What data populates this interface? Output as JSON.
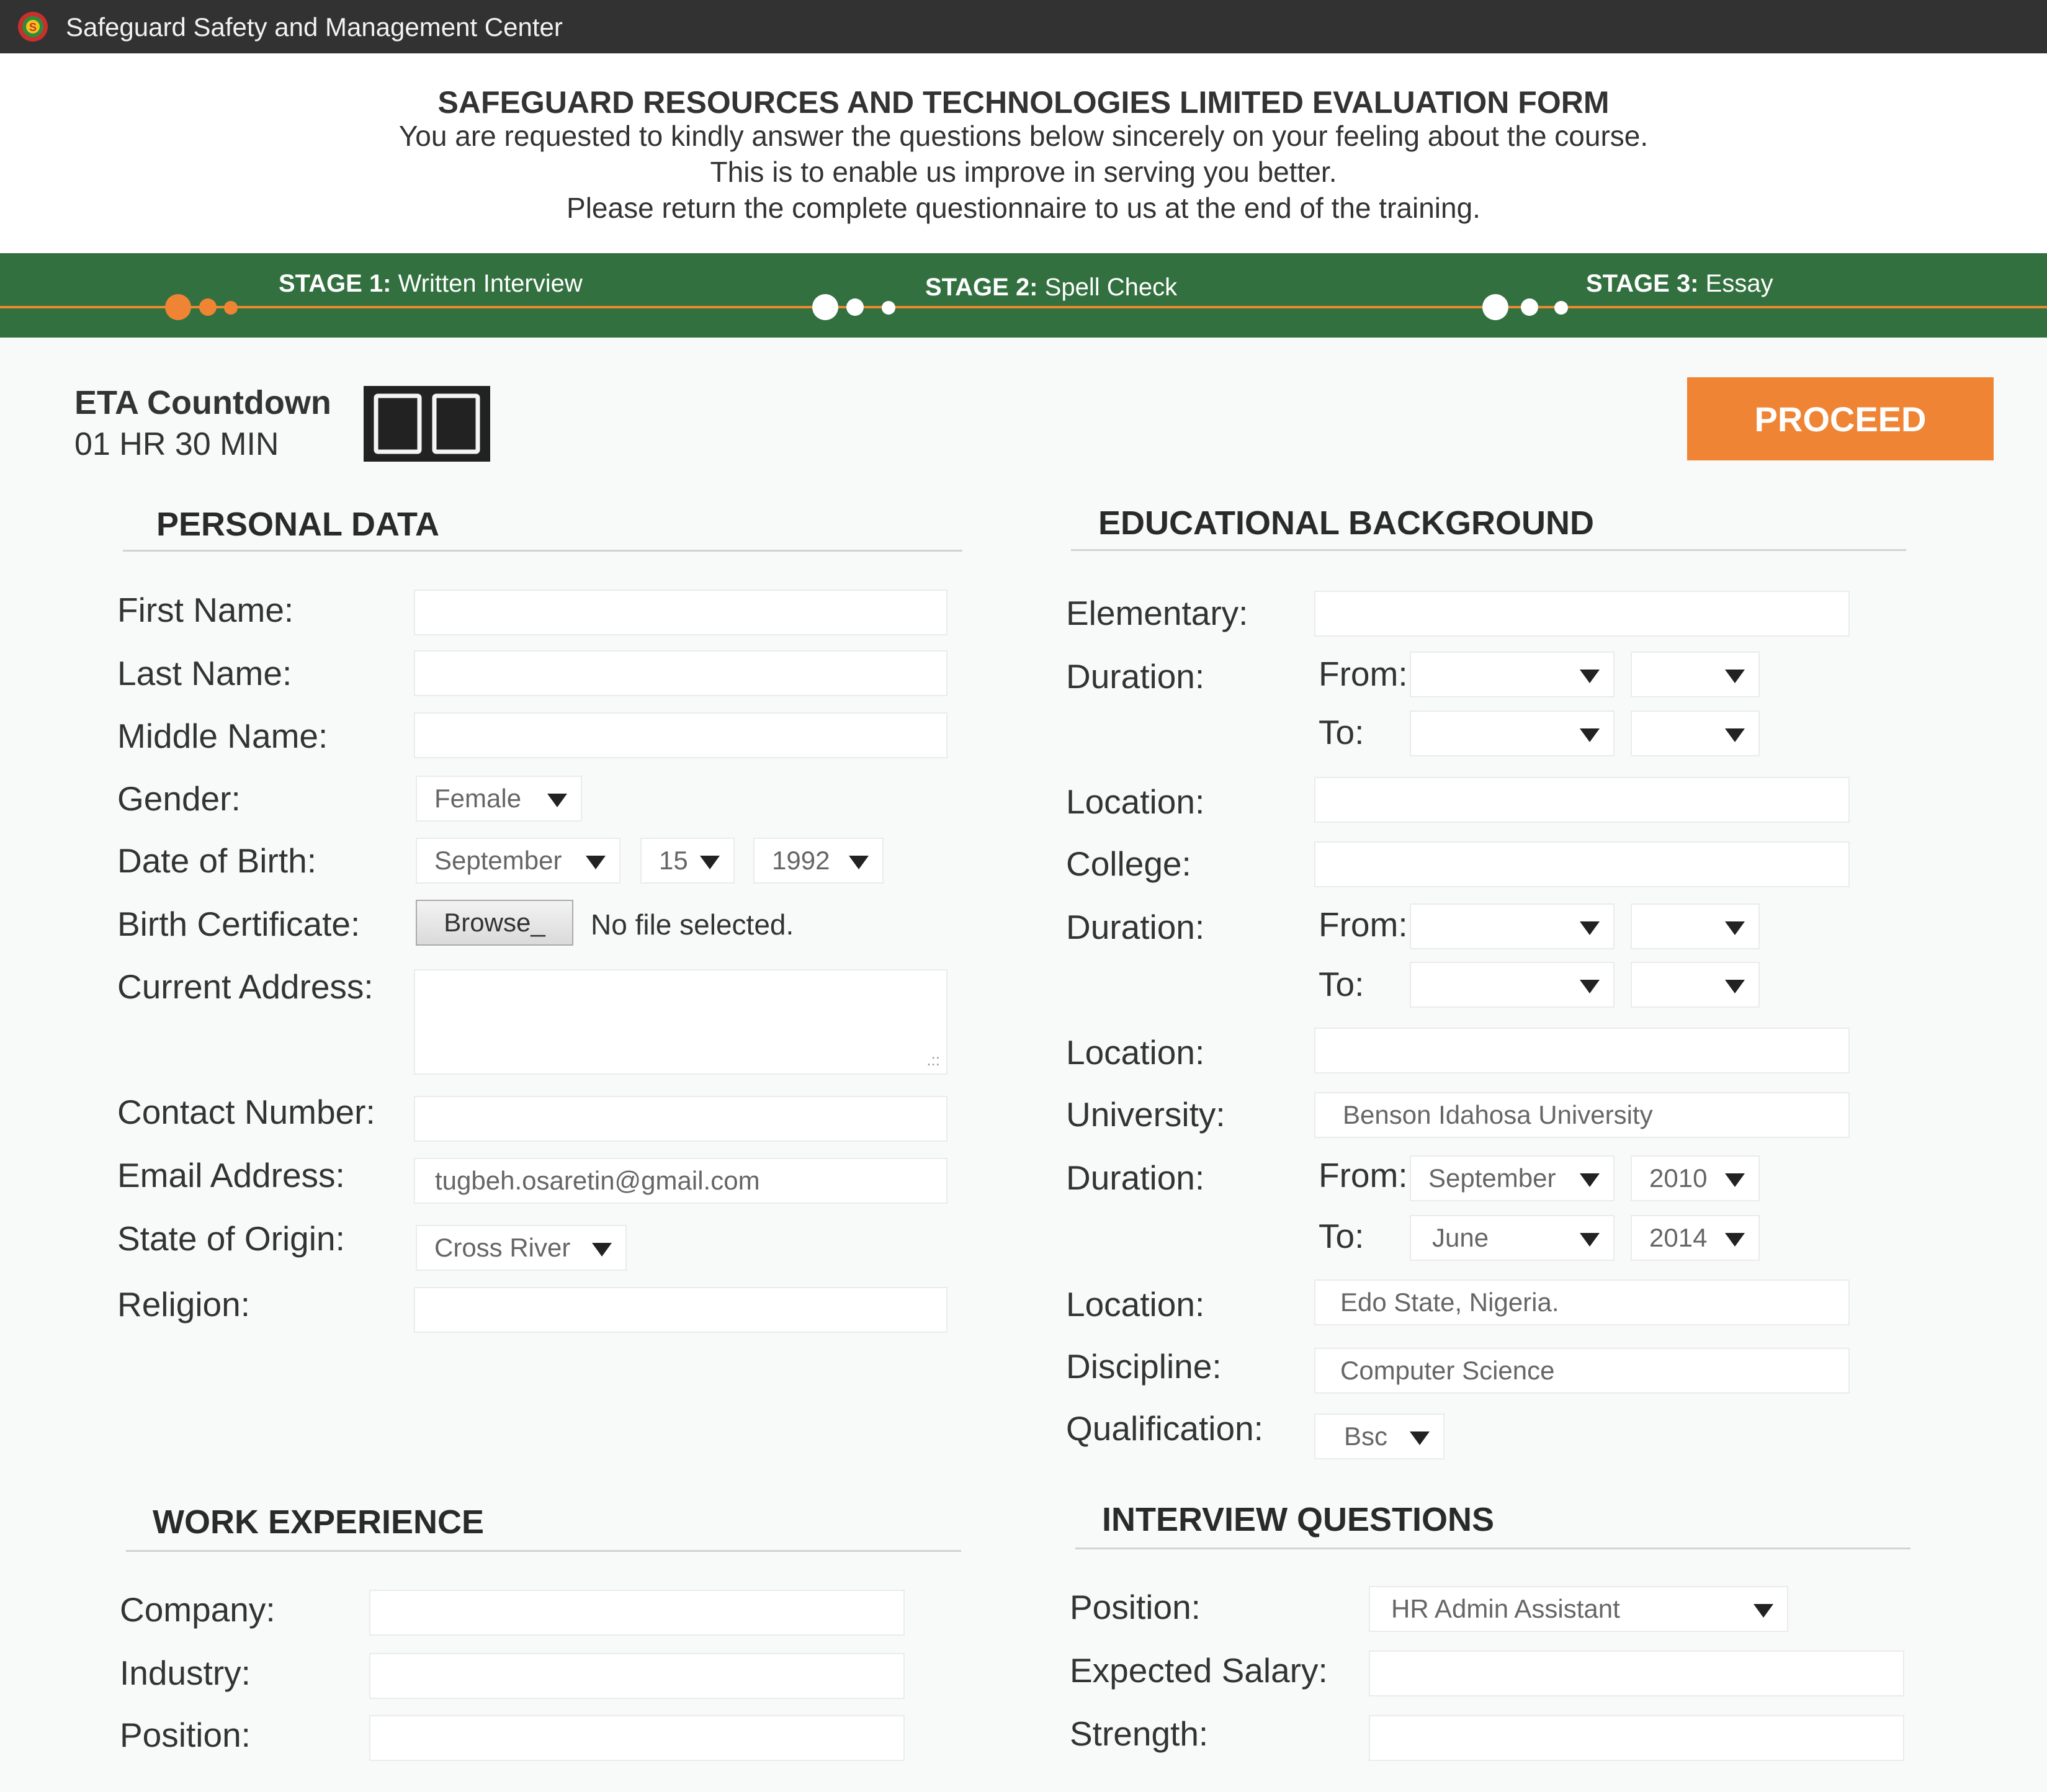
{
  "app": {
    "title": "Safeguard Safety and Management Center"
  },
  "header": {
    "title": "SAFEGUARD RESOURCES AND TECHNOLOGIES LIMITED EVALUATION FORM",
    "line1": "You are requested to kindly answer the questions below sincerely on your feeling about the course.",
    "line2": "This is to enable us improve in serving you better.",
    "line3": "Please return the complete questionnaire to us at the end of the training."
  },
  "stages": [
    {
      "num": "STAGE 1:",
      "name": "Written Interview",
      "active": true
    },
    {
      "num": "STAGE 2:",
      "name": "Spell Check",
      "active": false
    },
    {
      "num": "STAGE 3:",
      "name": "Essay",
      "active": false
    }
  ],
  "eta": {
    "title": "ETA Countdown",
    "value": "01 HR 30 MIN",
    "display": "00"
  },
  "proceed_label": "PROCEED",
  "personal": {
    "title": "PERSONAL DATA",
    "first_name": {
      "label": "First Name:",
      "value": ""
    },
    "last_name": {
      "label": "Last Name:",
      "value": ""
    },
    "middle_name": {
      "label": "Middle Name:",
      "value": ""
    },
    "gender": {
      "label": "Gender:",
      "value": "Female"
    },
    "dob": {
      "label": "Date of Birth:",
      "month": "September",
      "day": "15",
      "year": "1992"
    },
    "birth_cert": {
      "label": "Birth Certificate:",
      "button": "Browse_",
      "status": "No file selected."
    },
    "address": {
      "label": "Current Address:",
      "value": ""
    },
    "contact": {
      "label": "Contact Number:",
      "value": ""
    },
    "email": {
      "label": "Email Address:",
      "value": "tugbeh.osaretin@gmail.com"
    },
    "state": {
      "label": "State of Origin:",
      "value": "Cross River"
    },
    "religion": {
      "label": "Religion:",
      "value": ""
    }
  },
  "education": {
    "title": "EDUCATIONAL BACKGROUND",
    "elementary": {
      "label": "Elementary:",
      "value": ""
    },
    "duration_label": "Duration:",
    "from_label": "From:",
    "to_label": "To:",
    "location_label": "Location:",
    "elem_dates": {
      "from_month": "",
      "from_year": "",
      "to_month": "",
      "to_year": ""
    },
    "elem_location": "",
    "college": {
      "label": "College:",
      "value": ""
    },
    "college_dates": {
      "from_month": "",
      "from_year": "",
      "to_month": "",
      "to_year": ""
    },
    "college_location": "",
    "university": {
      "label": "University:",
      "value": "Benson Idahosa University"
    },
    "uni_dates": {
      "from_month": "September",
      "from_year": "2010",
      "to_month": "June",
      "to_year": "2014"
    },
    "uni_location": "Edo State, Nigeria.",
    "discipline": {
      "label": "Discipline:",
      "value": "Computer Science"
    },
    "qualification": {
      "label": "Qualification:",
      "value": "Bsc"
    }
  },
  "work": {
    "title": "WORK EXPERIENCE",
    "company": {
      "label": "Company:",
      "value": ""
    },
    "industry": {
      "label": "Industry:",
      "value": ""
    },
    "position": {
      "label": "Position:",
      "value": ""
    }
  },
  "interview": {
    "title": "INTERVIEW QUESTIONS",
    "position": {
      "label": "Position:",
      "value": "HR Admin Assistant"
    },
    "salary": {
      "label": "Expected Salary:",
      "value": ""
    },
    "strength": {
      "label": "Strength:",
      "value": ""
    }
  },
  "colors": {
    "accent": "#f08435",
    "stagebar": "#33703f",
    "titlebar": "#323232"
  }
}
